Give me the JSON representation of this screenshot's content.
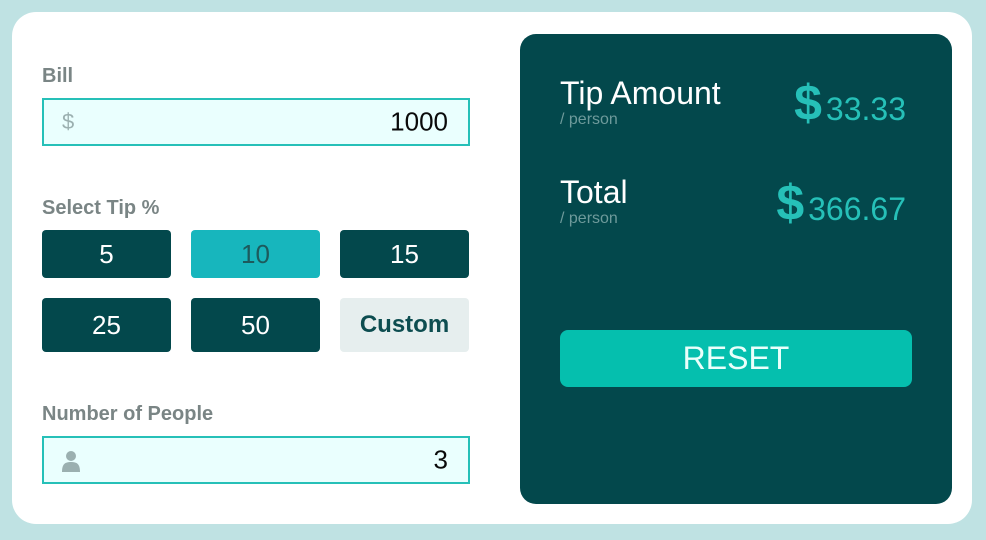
{
  "bill": {
    "label": "Bill",
    "currency_symbol": "$",
    "value": "1000"
  },
  "tip": {
    "label": "Select Tip %",
    "options": [
      "5",
      "10",
      "15",
      "25",
      "50"
    ],
    "selected": "10",
    "custom_label": "Custom"
  },
  "people": {
    "label": "Number of People",
    "value": "3",
    "icon": "person-icon"
  },
  "results": {
    "tip_amount": {
      "title": "Tip Amount",
      "subtitle": "/ person",
      "currency": "$",
      "value": "33.33"
    },
    "total": {
      "title": "Total",
      "subtitle": "/ person",
      "currency": "$",
      "value": "366.67"
    },
    "reset_label": "RESET"
  },
  "colors": {
    "background": "#bfe2e3",
    "dark_teal": "#03484c",
    "active_teal": "#17b6bd",
    "accent": "#26c0b8",
    "reset": "#05bfae"
  }
}
